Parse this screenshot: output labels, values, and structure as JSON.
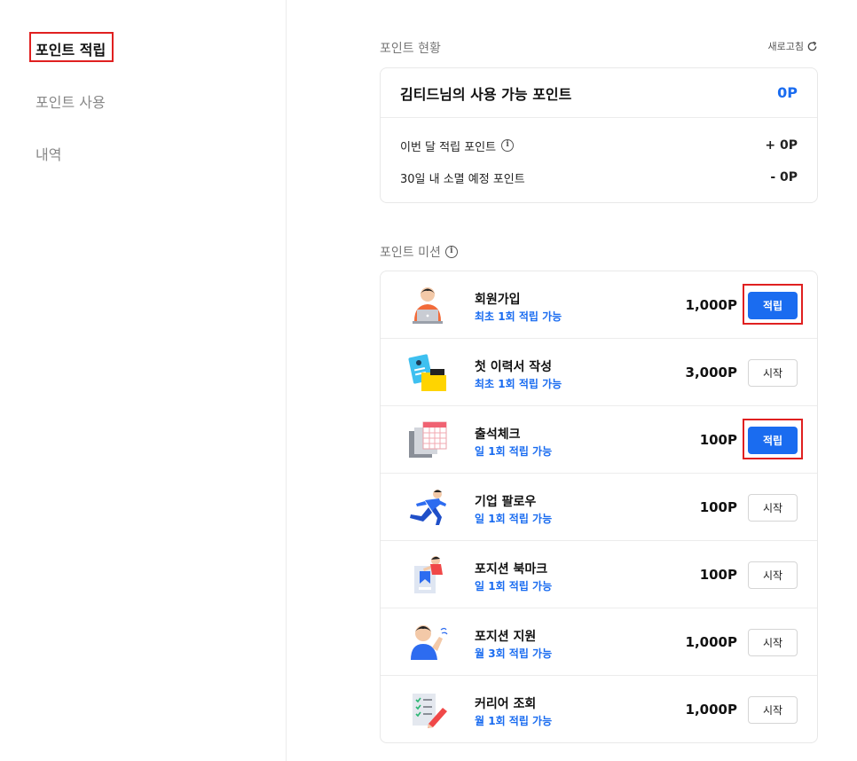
{
  "sidebar": {
    "items": [
      {
        "label": "포인트 적립"
      },
      {
        "label": "포인트 사용"
      },
      {
        "label": "내역"
      }
    ]
  },
  "status": {
    "section_title": "포인트 현황",
    "refresh_label": "새로고침",
    "title": "김티드님의 사용 가능 포인트",
    "total": "0P",
    "rows": [
      {
        "label": "이번 달 적립 포인트",
        "value": "+ 0P"
      },
      {
        "label": "30일 내 소멸 예정 포인트",
        "value": "- 0P"
      }
    ]
  },
  "missions": {
    "section_title": "포인트 미션",
    "items": [
      {
        "name": "회원가입",
        "limit": "최초 1회 적립 가능",
        "points": "1,000P",
        "button": "적립",
        "icon": "laptop-person-icon"
      },
      {
        "name": "첫 이력서 작성",
        "limit": "최초 1회 적립 가능",
        "points": "3,000P",
        "button": "시작",
        "icon": "resume-folder-icon"
      },
      {
        "name": "출석체크",
        "limit": "일 1회 적립 가능",
        "points": "100P",
        "button": "적립",
        "icon": "calendar-icon"
      },
      {
        "name": "기업 팔로우",
        "limit": "일 1회 적립 가능",
        "points": "100P",
        "button": "시작",
        "icon": "running-person-icon"
      },
      {
        "name": "포지션 북마크",
        "limit": "일 1회 적립 가능",
        "points": "100P",
        "button": "시작",
        "icon": "bookmark-person-icon"
      },
      {
        "name": "포지션 지원",
        "limit": "월 3회 적립 가능",
        "points": "1,000P",
        "button": "시작",
        "icon": "apply-person-icon"
      },
      {
        "name": "커리어 조회",
        "limit": "월 1회 적립 가능",
        "points": "1,000P",
        "button": "시작",
        "icon": "checklist-pencil-icon"
      }
    ]
  },
  "colors": {
    "accent": "#1a6cf0",
    "highlight": "#e02020"
  }
}
